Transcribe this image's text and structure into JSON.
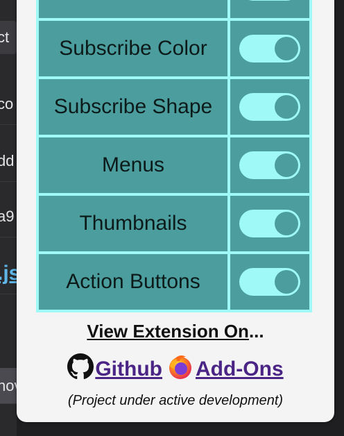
{
  "background_app": {
    "items": [
      {
        "text": "ct",
        "kind": "tab"
      },
      {
        "text": "co",
        "kind": "text"
      },
      {
        "text": "dd",
        "kind": "text"
      },
      {
        "text": "a9",
        "kind": "text"
      },
      {
        "text": ".js",
        "kind": "link"
      },
      {
        "text": "nov",
        "kind": "btn"
      }
    ]
  },
  "settings": {
    "rows": [
      {
        "label": "",
        "enabled": true
      },
      {
        "label": "Subscribe Color",
        "enabled": true
      },
      {
        "label": "Subscribe Shape",
        "enabled": true
      },
      {
        "label": "Menus",
        "enabled": true
      },
      {
        "label": "Thumbnails",
        "enabled": true
      },
      {
        "label": "Action Buttons",
        "enabled": true
      }
    ]
  },
  "footer": {
    "view_title_underlined": "View Extension On",
    "view_title_suffix": "...",
    "github_label": "Github",
    "addons_label": "Add-Ons",
    "note": "(Project under active development)"
  },
  "colors": {
    "cell": "#4c9e9e",
    "accent": "#9ff9f6",
    "link": "#4b2585",
    "popup_bg": "#f4f4f4"
  },
  "icons": {
    "github": "github-icon",
    "firefox": "firefox-icon"
  }
}
